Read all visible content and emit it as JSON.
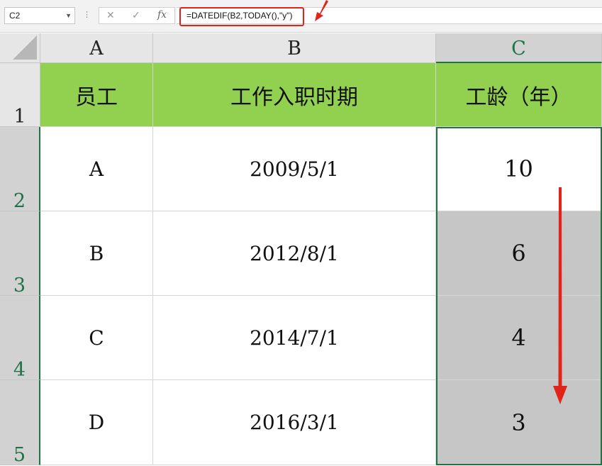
{
  "formula_bar": {
    "name_box": "C2",
    "formula": "=DATEDIF(B2,TODAY(),\"y\")",
    "cancel_symbol": "✕",
    "enter_symbol": "✓",
    "fx_symbol": "fx"
  },
  "columns": [
    "A",
    "B",
    "C"
  ],
  "selected_column": "C",
  "rows": [
    "1",
    "2",
    "3",
    "4",
    "5"
  ],
  "header_row": [
    "员工",
    "工作入职时期",
    "工龄（年）"
  ],
  "data_rows": [
    [
      "A",
      "2009/5/1",
      "10"
    ],
    [
      "B",
      "2012/8/1",
      "6"
    ],
    [
      "C",
      "2014/7/1",
      "4"
    ],
    [
      "D",
      "2016/3/1",
      "3"
    ]
  ],
  "colors": {
    "header_fill": "#92d050",
    "selection_border": "#217346",
    "annotation": "#e2231a",
    "selected_fill": "#c6c6c6"
  },
  "icons": [
    "dropdown-caret-icon",
    "cancel-icon",
    "enter-icon",
    "fx-icon",
    "annotation-arrow-icon",
    "corner-select-all-icon"
  ]
}
